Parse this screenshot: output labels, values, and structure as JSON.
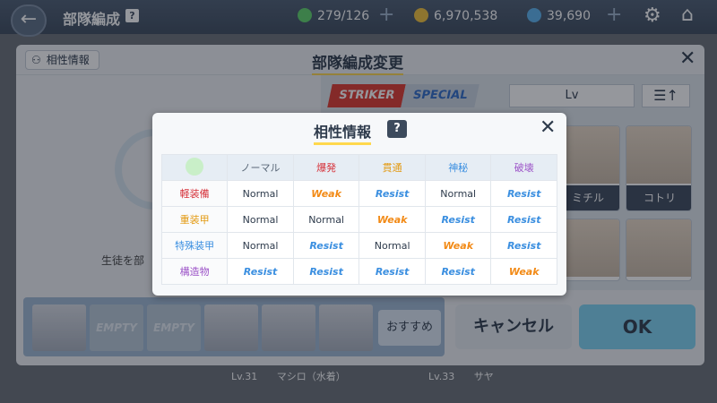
{
  "topbar": {
    "title": "部隊編成",
    "help": "?",
    "ap": "279/126",
    "credits": "6,970,538",
    "gems": "39,690"
  },
  "panel": {
    "info_button": "相性情報",
    "title": "部隊編成変更",
    "left_text": "生徒を部",
    "tabs": {
      "striker": "STRIKER",
      "special": "SPECIAL"
    },
    "sort_label": "Lv",
    "cards": [
      {
        "name": "ミチル"
      },
      {
        "name": "コトリ"
      }
    ],
    "slots": [
      "",
      "EMPTY",
      "EMPTY",
      "",
      "",
      ""
    ],
    "recommend": "おすすめ",
    "cancel": "キャンセル",
    "ok": "OK"
  },
  "below_list": [
    {
      "level": "Lv.31",
      "name": "マシロ（水着）"
    },
    {
      "level": "Lv.33",
      "name": "サヤ"
    }
  ],
  "modal": {
    "title": "相性情報",
    "help": "?",
    "columns": [
      {
        "label": "ノーマル",
        "color": "#5a6878"
      },
      {
        "label": "爆発",
        "color": "#d6323a"
      },
      {
        "label": "貫通",
        "color": "#e39a12"
      },
      {
        "label": "神秘",
        "color": "#3b8fe0"
      },
      {
        "label": "破壊",
        "color": "#9d55c8"
      }
    ],
    "rows": [
      {
        "label": "軽装備",
        "color": "#d6323a",
        "values": [
          "Normal",
          "Weak",
          "Resist",
          "Normal",
          "Resist"
        ]
      },
      {
        "label": "重装甲",
        "color": "#e39a12",
        "values": [
          "Normal",
          "Normal",
          "Weak",
          "Resist",
          "Resist"
        ]
      },
      {
        "label": "特殊装甲",
        "color": "#3b8fe0",
        "values": [
          "Normal",
          "Resist",
          "Normal",
          "Weak",
          "Resist"
        ]
      },
      {
        "label": "構造物",
        "color": "#9d55c8",
        "values": [
          "Resist",
          "Resist",
          "Resist",
          "Resist",
          "Weak"
        ]
      }
    ]
  }
}
